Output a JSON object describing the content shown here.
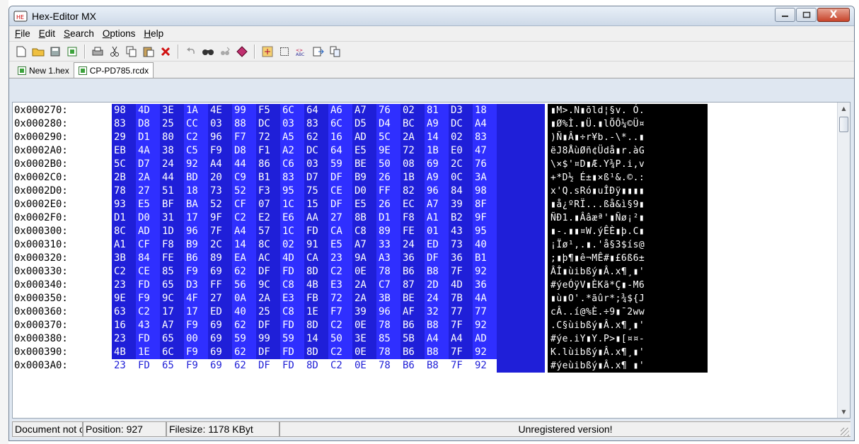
{
  "window": {
    "title": "Hex-Editor MX",
    "minimize_label": "—",
    "maximize_label": "□",
    "close_label": "X"
  },
  "menu": [
    {
      "label": "File",
      "key": "F",
      "rest": "ile"
    },
    {
      "label": "Edit",
      "key": "E",
      "rest": "dit"
    },
    {
      "label": "Search",
      "key": "S",
      "rest": "earch"
    },
    {
      "label": "Options",
      "key": "O",
      "rest": "ptions"
    },
    {
      "label": "Help",
      "key": "H",
      "rest": "elp"
    }
  ],
  "toolbar_icons": [
    "new-file-icon",
    "open-folder-icon",
    "save-icon",
    "save-all-icon",
    "print-icon",
    "cut-icon",
    "copy-icon",
    "paste-icon",
    "delete-icon",
    "undo-icon",
    "find-icon",
    "find-next-icon",
    "bookmark-icon",
    "calculator-icon",
    "select-icon",
    "convert-icon",
    "export-icon",
    "compare-icon"
  ],
  "tabs": [
    {
      "label": "New 1.hex",
      "active": false
    },
    {
      "label": "CP-PD785.rcdx",
      "active": true
    }
  ],
  "rows": [
    {
      "offset": "0x000270:",
      "hex": [
        "98",
        "4D",
        "3E",
        "1A",
        "4E",
        "99",
        "F5",
        "6C",
        "64",
        "A6",
        "A7",
        "76",
        "02",
        "81",
        "D3",
        "18"
      ],
      "ascii": "▮M>.N▮õld¦§v. Ó."
    },
    {
      "offset": "0x000280:",
      "hex": [
        "83",
        "D8",
        "25",
        "CC",
        "03",
        "88",
        "DC",
        "03",
        "83",
        "6C",
        "D5",
        "D4",
        "BC",
        "A9",
        "DC",
        "A4"
      ],
      "ascii": "▮Ø%Ì.▮Ü.▮lÕÔ¼©Ü¤"
    },
    {
      "offset": "0x000290:",
      "hex": [
        "29",
        "D1",
        "80",
        "C2",
        "96",
        "F7",
        "72",
        "A5",
        "62",
        "16",
        "AD",
        "5C",
        "2A",
        "14",
        "02",
        "83"
      ],
      "ascii": ")Ñ▮Â▮÷r¥b.-\\*..▮"
    },
    {
      "offset": "0x0002A0:",
      "hex": [
        "EB",
        "4A",
        "38",
        "C5",
        "F9",
        "D8",
        "F1",
        "A2",
        "DC",
        "64",
        "E5",
        "9E",
        "72",
        "1B",
        "E0",
        "47"
      ],
      "ascii": "ëJ8ÅùØñ¢Üdå▮r.àG"
    },
    {
      "offset": "0x0002B0:",
      "hex": [
        "5C",
        "D7",
        "24",
        "92",
        "A4",
        "44",
        "86",
        "C6",
        "03",
        "59",
        "BE",
        "50",
        "08",
        "69",
        "2C",
        "76"
      ],
      "ascii": "\\×$'¤D▮Æ.Y¾P.i,v"
    },
    {
      "offset": "0x0002C0:",
      "hex": [
        "2B",
        "2A",
        "44",
        "BD",
        "20",
        "C9",
        "B1",
        "83",
        "D7",
        "DF",
        "B9",
        "26",
        "1B",
        "A9",
        "0C",
        "3A"
      ],
      "ascii": "+*D½ É±▮×ß¹&.©.:"
    },
    {
      "offset": "0x0002D0:",
      "hex": [
        "78",
        "27",
        "51",
        "18",
        "73",
        "52",
        "F3",
        "95",
        "75",
        "CE",
        "D0",
        "FF",
        "82",
        "96",
        "84",
        "98"
      ],
      "ascii": "x'Q.sRó▮uÎÐÿ▮▮▮▮"
    },
    {
      "offset": "0x0002E0:",
      "hex": [
        "93",
        "E5",
        "BF",
        "BA",
        "52",
        "CF",
        "07",
        "1C",
        "15",
        "DF",
        "E5",
        "26",
        "EC",
        "A7",
        "39",
        "8F"
      ],
      "ascii": "▮å¿ºRÏ...ßå&ì§9▮"
    },
    {
      "offset": "0x0002F0:",
      "hex": [
        "D1",
        "D0",
        "31",
        "17",
        "9F",
        "C2",
        "E2",
        "E6",
        "AA",
        "27",
        "8B",
        "D1",
        "F8",
        "A1",
        "B2",
        "9F"
      ],
      "ascii": "ÑÐ1.▮Ââæª'▮Ñø¡²▮"
    },
    {
      "offset": "0x000300:",
      "hex": [
        "8C",
        "AD",
        "1D",
        "96",
        "7F",
        "A4",
        "57",
        "1C",
        "FD",
        "CA",
        "C8",
        "89",
        "FE",
        "01",
        "43",
        "95"
      ],
      "ascii": "▮-.▮▮¤W.ýÊÈ▮þ.C▮"
    },
    {
      "offset": "0x000310:",
      "hex": [
        "A1",
        "CF",
        "F8",
        "B9",
        "2C",
        "14",
        "8C",
        "02",
        "91",
        "E5",
        "A7",
        "33",
        "24",
        "ED",
        "73",
        "40"
      ],
      "ascii": "¡Ïø¹,.▮.'å§3$ís@"
    },
    {
      "offset": "0x000320:",
      "hex": [
        "3B",
        "84",
        "FE",
        "B6",
        "89",
        "EA",
        "AC",
        "4D",
        "CA",
        "23",
        "9A",
        "A3",
        "36",
        "DF",
        "36",
        "B1"
      ],
      "ascii": ";▮þ¶▮ê¬MÊ#▮£6ß6±"
    },
    {
      "offset": "0x000330:",
      "hex": [
        "C2",
        "CE",
        "85",
        "F9",
        "69",
        "62",
        "DF",
        "FD",
        "8D",
        "C2",
        "0E",
        "78",
        "B6",
        "B8",
        "7F",
        "92"
      ],
      "ascii": "ÂÎ▮ùibßý▮Â.x¶¸▮'"
    },
    {
      "offset": "0x000340:",
      "hex": [
        "23",
        "FD",
        "65",
        "D3",
        "FF",
        "56",
        "9C",
        "C8",
        "4B",
        "E3",
        "2A",
        "C7",
        "87",
        "2D",
        "4D",
        "36"
      ],
      "ascii": "#ýeÓÿV▮ÈKã*Ç▮-M6"
    },
    {
      "offset": "0x000350:",
      "hex": [
        "9E",
        "F9",
        "9C",
        "4F",
        "27",
        "0A",
        "2A",
        "E3",
        "FB",
        "72",
        "2A",
        "3B",
        "BE",
        "24",
        "7B",
        "4A"
      ],
      "ascii": "▮ù▮O'.*ãûr*;¾${J"
    },
    {
      "offset": "0x000360:",
      "hex": [
        "63",
        "C2",
        "17",
        "17",
        "ED",
        "40",
        "25",
        "C8",
        "1E",
        "F7",
        "39",
        "96",
        "AF",
        "32",
        "77",
        "77"
      ],
      "ascii": "cÂ..í@%È.÷9▮¯2ww"
    },
    {
      "offset": "0x000370:",
      "hex": [
        "16",
        "43",
        "A7",
        "F9",
        "69",
        "62",
        "DF",
        "FD",
        "8D",
        "C2",
        "0E",
        "78",
        "B6",
        "B8",
        "7F",
        "92"
      ],
      "ascii": ".C§ùibßý▮Â.x¶¸▮'"
    },
    {
      "offset": "0x000380:",
      "hex": [
        "23",
        "FD",
        "65",
        "00",
        "69",
        "59",
        "99",
        "59",
        "14",
        "50",
        "3E",
        "85",
        "5B",
        "A4",
        "A4",
        "AD"
      ],
      "ascii": "#ýe.iY▮Y.P>▮[¤¤-"
    },
    {
      "offset": "0x000390:",
      "hex": [
        "4B",
        "1E",
        "6C",
        "F9",
        "69",
        "62",
        "DF",
        "FD",
        "8D",
        "C2",
        "0E",
        "78",
        "B6",
        "B8",
        "7F",
        "92"
      ],
      "ascii": "K.lùibßý▮Â.x¶¸▮'"
    },
    {
      "offset": "0x0003A0:",
      "hex": [
        "23",
        "FD",
        "65",
        "F9",
        "69",
        "62",
        "DF",
        "FD",
        "8D",
        "C2",
        "0E",
        "78",
        "B6",
        "B8",
        "7F",
        "92"
      ],
      "ascii": "#ýeùibßý▮Â.x¶ ▮'"
    }
  ],
  "status": {
    "document": "Document not c",
    "position": "Position: 927",
    "filesize": "Filesize: 1178 KByt",
    "registration": "Unregistered version!"
  },
  "colors": {
    "hex_bg": "#1f1fd8",
    "hex_alt_bg": "#2f2fff",
    "ascii_bg": "#000000",
    "text_white": "#ffffff"
  }
}
